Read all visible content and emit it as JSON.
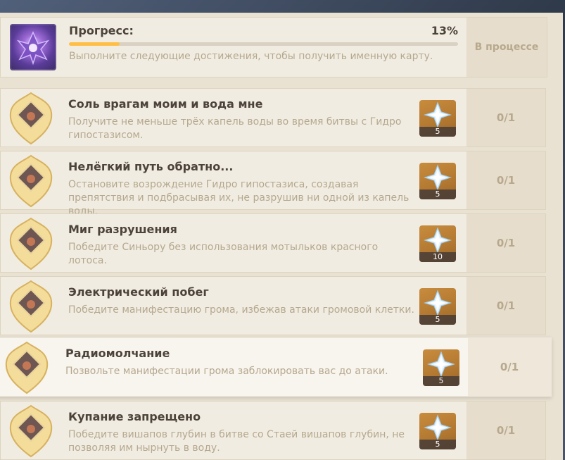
{
  "progress": {
    "title": "Прогресс:",
    "percent_label": "13%",
    "percent_value": 13,
    "description": "Выполните следующие достижения, чтобы получить именную карту.",
    "status": "В процессе"
  },
  "achievements": [
    {
      "title": "Соль врагам моим и вода мне",
      "description": "Получите не меньше трёх капель воды во время битвы с Гидро гипостазисом.",
      "reward_count": "5",
      "status": "0/1"
    },
    {
      "title": "Нелёгкий путь обратно...",
      "description": "Остановите возрождение Гидро гипостазиса, создавая препятствия и подбрасывая их, не разрушив ни одной из капель воды.",
      "reward_count": "5",
      "status": "0/1"
    },
    {
      "title": "Миг разрушения",
      "description": "Победите Синьору без использования мотыльков красного лотоса.",
      "reward_count": "10",
      "status": "0/1"
    },
    {
      "title": "Электрический побег",
      "description": "Победите манифестацию грома, избежав атаки громовой клетки.",
      "reward_count": "5",
      "status": "0/1"
    },
    {
      "title": "Радиомолчание",
      "description": "Позвольте манифестации грома заблокировать вас до атаки.",
      "reward_count": "5",
      "status": "0/1"
    },
    {
      "title": "Купание запрещено",
      "description": "Победите вишапов глубин в битве со Стаей вишапов глубин, не позволяя им нырнуть в воду.",
      "reward_count": "5",
      "status": "0/1"
    }
  ],
  "colors": {
    "progress_fill": "#ffbf46",
    "title_text": "#4c433a",
    "desc_text": "#b5a88f",
    "reward_bg": "#b47a32"
  },
  "icons": {
    "namecard": "namecard-icon",
    "badge": "achievement-badge-icon",
    "reward": "primogem-icon"
  }
}
